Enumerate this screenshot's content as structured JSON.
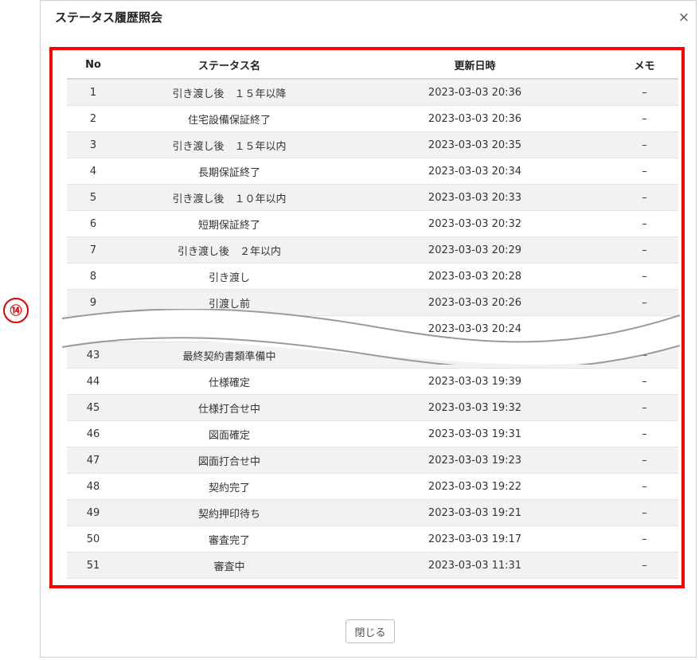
{
  "modal": {
    "title": "ステータス履歴照会",
    "close_icon": "×",
    "close_button_label": "閉じる"
  },
  "annotation": {
    "label": "⑭",
    "color": "#ff0000"
  },
  "table": {
    "headers": {
      "no": "No",
      "status": "ステータス名",
      "updated": "更新日時",
      "memo": "メモ"
    },
    "rows_top": [
      {
        "no": "1",
        "status": "引き渡し後　１５年以降",
        "updated": "2023-03-03 20:36",
        "memo": "–"
      },
      {
        "no": "2",
        "status": "住宅設備保証終了",
        "updated": "2023-03-03 20:36",
        "memo": "–"
      },
      {
        "no": "3",
        "status": "引き渡し後　１５年以内",
        "updated": "2023-03-03 20:35",
        "memo": "–"
      },
      {
        "no": "4",
        "status": "長期保証終了",
        "updated": "2023-03-03 20:34",
        "memo": "–"
      },
      {
        "no": "5",
        "status": "引き渡し後　１０年以内",
        "updated": "2023-03-03 20:33",
        "memo": "–"
      },
      {
        "no": "6",
        "status": "短期保証終了",
        "updated": "2023-03-03 20:32",
        "memo": "–"
      },
      {
        "no": "7",
        "status": "引き渡し後　２年以内",
        "updated": "2023-03-03 20:29",
        "memo": "–"
      },
      {
        "no": "8",
        "status": "引き渡し",
        "updated": "2023-03-03 20:28",
        "memo": "–"
      },
      {
        "no": "9",
        "status": "引渡し前",
        "updated": "2023-03-03 20:26",
        "memo": "–"
      },
      {
        "no": "",
        "status": "",
        "updated": "2023-03-03 20:24",
        "memo": "–"
      }
    ],
    "rows_bottom": [
      {
        "no": "43",
        "status": "最終契約書類準備中",
        "updated": "",
        "memo": "–"
      },
      {
        "no": "44",
        "status": "仕様確定",
        "updated": "2023-03-03 19:39",
        "memo": "–"
      },
      {
        "no": "45",
        "status": "仕様打合せ中",
        "updated": "2023-03-03 19:32",
        "memo": "–"
      },
      {
        "no": "46",
        "status": "図面確定",
        "updated": "2023-03-03 19:31",
        "memo": "–"
      },
      {
        "no": "47",
        "status": "図面打合せ中",
        "updated": "2023-03-03 19:23",
        "memo": "–"
      },
      {
        "no": "48",
        "status": "契約完了",
        "updated": "2023-03-03 19:22",
        "memo": "–"
      },
      {
        "no": "49",
        "status": "契約押印待ち",
        "updated": "2023-03-03 19:21",
        "memo": "–"
      },
      {
        "no": "50",
        "status": "審査完了",
        "updated": "2023-03-03 19:17",
        "memo": "–"
      },
      {
        "no": "51",
        "status": "審査中",
        "updated": "2023-03-03 11:31",
        "memo": "–"
      }
    ]
  }
}
